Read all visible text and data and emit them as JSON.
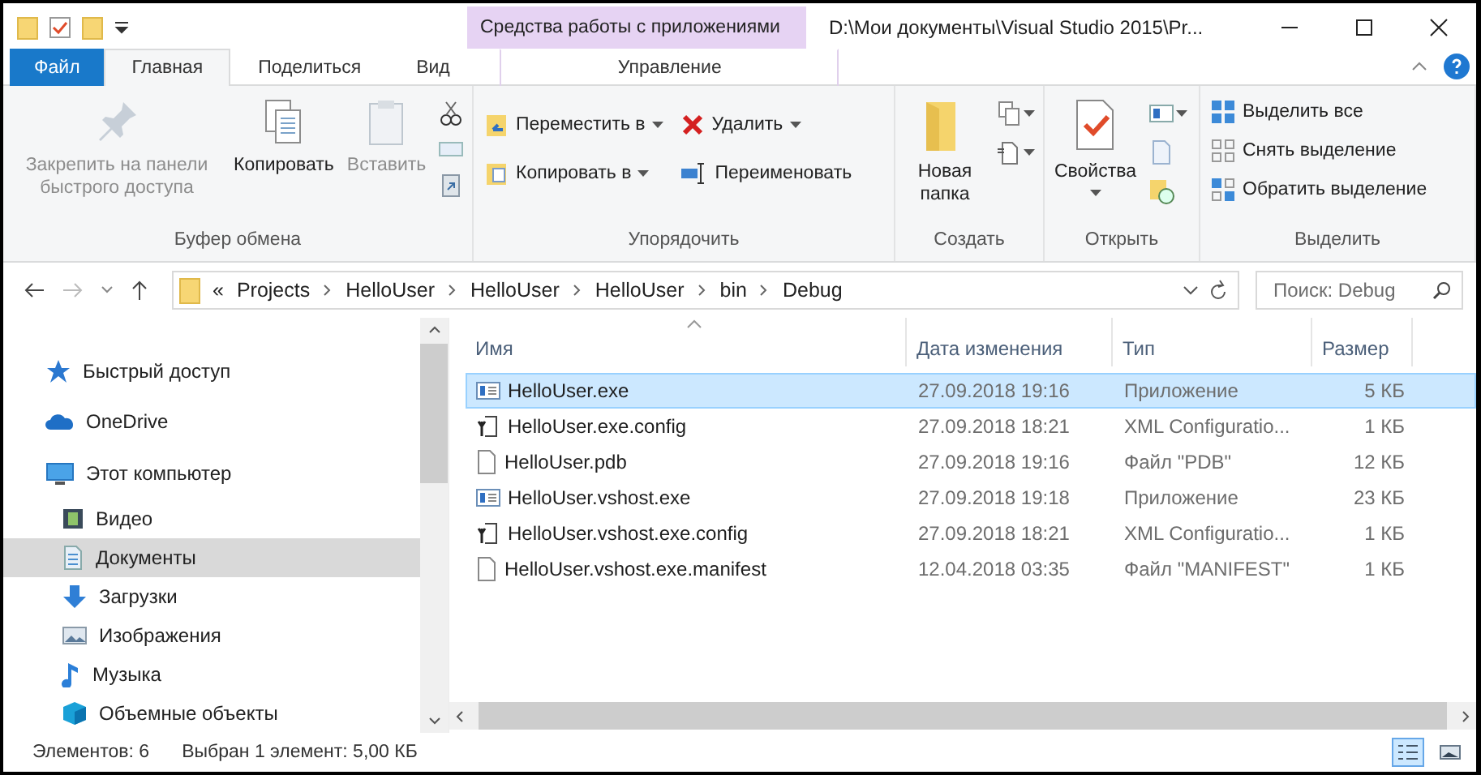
{
  "title_bar": {
    "context_group": "Средства работы с приложениями",
    "title": "D:\\Мои документы\\Visual Studio 2015\\Pr..."
  },
  "ribbon_tabs": [
    {
      "label": "Файл",
      "kind": "file",
      "selected": false
    },
    {
      "label": "Главная",
      "kind": "tab",
      "selected": true
    },
    {
      "label": "Поделиться",
      "kind": "tab",
      "selected": false
    },
    {
      "label": "Вид",
      "kind": "tab",
      "selected": false
    },
    {
      "label": "Управление",
      "kind": "contextual",
      "selected": false
    }
  ],
  "ribbon_groups": [
    {
      "title": "Буфер обмена",
      "commands": [
        {
          "label": "Закрепить на панели быстрого доступа",
          "kind": "large",
          "disabled": true,
          "dropdown": false
        },
        {
          "label": "Копировать",
          "kind": "large",
          "disabled": false,
          "dropdown": false
        },
        {
          "label": "Вставить",
          "kind": "large",
          "disabled": true,
          "dropdown": false
        }
      ]
    },
    {
      "title": "Упорядочить",
      "commands": [
        {
          "label": "Переместить в",
          "kind": "small",
          "disabled": false,
          "dropdown": true
        },
        {
          "label": "Копировать в",
          "kind": "small",
          "disabled": false,
          "dropdown": true
        },
        {
          "label": "Удалить",
          "kind": "small",
          "disabled": false,
          "dropdown": true
        },
        {
          "label": "Переименовать",
          "kind": "small",
          "disabled": false,
          "dropdown": false
        }
      ]
    },
    {
      "title": "Создать",
      "commands": [
        {
          "label": "Новая папка",
          "kind": "large",
          "disabled": false,
          "dropdown": false
        }
      ]
    },
    {
      "title": "Открыть",
      "commands": [
        {
          "label": "Свойства",
          "kind": "large",
          "disabled": false,
          "dropdown": true
        }
      ]
    },
    {
      "title": "Выделить",
      "commands": [
        {
          "label": "Выделить все",
          "kind": "small",
          "disabled": false,
          "dropdown": false
        },
        {
          "label": "Снять выделение",
          "kind": "small",
          "disabled": false,
          "dropdown": false
        },
        {
          "label": "Обратить выделение",
          "kind": "small",
          "disabled": false,
          "dropdown": false
        }
      ]
    }
  ],
  "address_bar": {
    "overflow": "«",
    "crumbs": [
      "Projects",
      "HelloUser",
      "HelloUser",
      "HelloUser",
      "bin",
      "Debug"
    ]
  },
  "search": {
    "placeholder": "Поиск: Debug"
  },
  "navigation": [
    {
      "label": "Быстрый доступ",
      "selected": false
    },
    {
      "label": "OneDrive",
      "selected": false
    },
    {
      "label": "Этот компьютер",
      "selected": false,
      "children": [
        {
          "label": "Видео",
          "selected": false
        },
        {
          "label": "Документы",
          "selected": true
        },
        {
          "label": "Загрузки",
          "selected": false
        },
        {
          "label": "Изображения",
          "selected": false
        },
        {
          "label": "Музыка",
          "selected": false
        },
        {
          "label": "Объемные объекты",
          "selected": false
        }
      ]
    }
  ],
  "columns": [
    {
      "label": "Имя",
      "sorted": true
    },
    {
      "label": "Дата изменения",
      "sorted": false
    },
    {
      "label": "Тип",
      "sorted": false
    },
    {
      "label": "Размер",
      "sorted": false
    }
  ],
  "files": [
    {
      "name": "HelloUser.exe",
      "modified": "27.09.2018 19:16",
      "type": "Приложение",
      "size": "5 КБ",
      "kind": "exe",
      "selected": true
    },
    {
      "name": "HelloUser.exe.config",
      "modified": "27.09.2018 18:21",
      "type": "XML Configuratio...",
      "size": "1 КБ",
      "kind": "config",
      "selected": false
    },
    {
      "name": "HelloUser.pdb",
      "modified": "27.09.2018 19:16",
      "type": "Файл \"PDB\"",
      "size": "12 КБ",
      "kind": "file",
      "selected": false
    },
    {
      "name": "HelloUser.vshost.exe",
      "modified": "27.09.2018 19:18",
      "type": "Приложение",
      "size": "23 КБ",
      "kind": "exe",
      "selected": false
    },
    {
      "name": "HelloUser.vshost.exe.config",
      "modified": "27.09.2018 18:21",
      "type": "XML Configuratio...",
      "size": "1 КБ",
      "kind": "config",
      "selected": false
    },
    {
      "name": "HelloUser.vshost.exe.manifest",
      "modified": "12.04.2018 03:35",
      "type": "Файл \"MANIFEST\"",
      "size": "1 КБ",
      "kind": "file",
      "selected": false
    }
  ],
  "status_bar": {
    "item_count": "Элементов: 6",
    "selection": "Выбран 1 элемент: 5,00 КБ"
  },
  "view_modes": [
    {
      "selected": true
    },
    {
      "selected": false
    }
  ]
}
